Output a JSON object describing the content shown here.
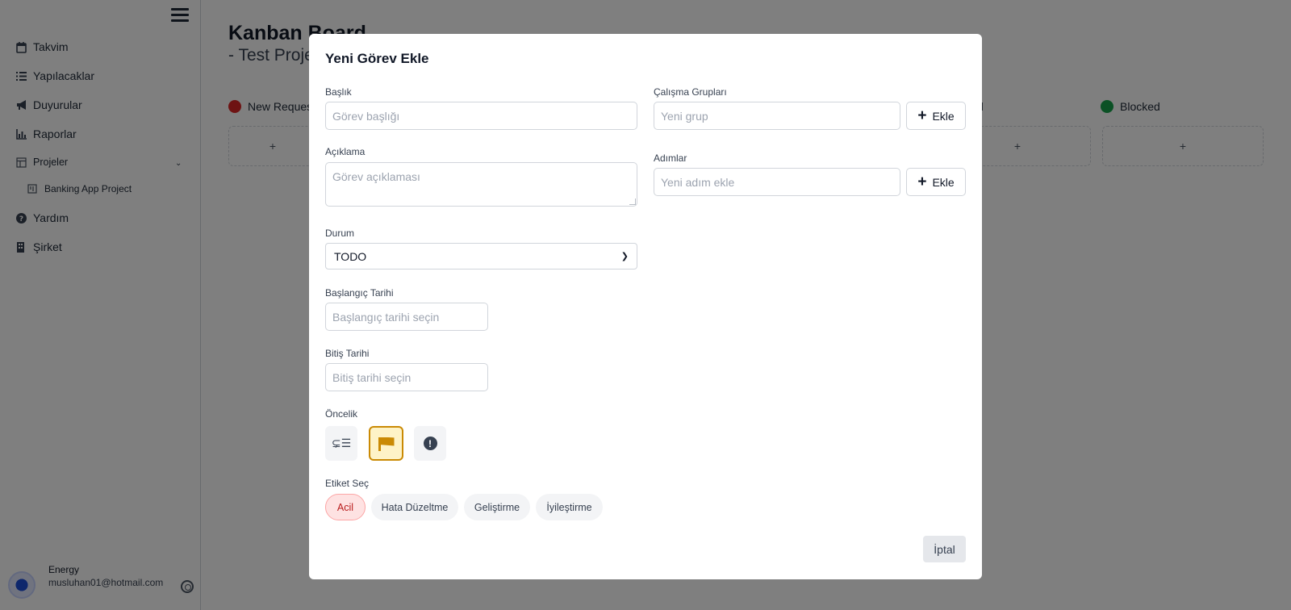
{
  "sidebar": {
    "items": [
      {
        "label": "Takvim",
        "icon": "calendar-icon"
      },
      {
        "label": "Yapılacaklar",
        "icon": "list-icon"
      },
      {
        "label": "Duyurular",
        "icon": "megaphone-icon"
      },
      {
        "label": "Raporlar",
        "icon": "chart-icon"
      },
      {
        "label": "Projeler",
        "icon": "table-icon"
      },
      {
        "label": "Banking App Project",
        "icon": "board-icon"
      },
      {
        "label": "Yardım",
        "icon": "help-icon"
      },
      {
        "label": "Şirket",
        "icon": "building-icon"
      }
    ],
    "user": {
      "name": "Energy",
      "email": "musluhan01@hotmail.com"
    }
  },
  "main": {
    "title": "Kanban Board",
    "subtitle": "- Test Proje",
    "columns": [
      {
        "label": "New Reques",
        "color": "#dc2626"
      },
      {
        "label": "d",
        "color": ""
      },
      {
        "label": "Blocked",
        "color": "#16a34a"
      }
    ],
    "add_symbol": "+"
  },
  "modal": {
    "title": "Yeni Görev Ekle",
    "baslik_label": "Başlık",
    "baslik_placeholder": "Görev başlığı",
    "aciklama_label": "Açıklama",
    "aciklama_placeholder": "Görev açıklaması",
    "durum_label": "Durum",
    "durum_value": "TODO",
    "baslangic_label": "Başlangıç Tarihi",
    "baslangic_placeholder": "Başlangıç tarihi seçin",
    "bitis_label": "Bitiş Tarihi",
    "bitis_placeholder": "Bitiş tarihi seçin",
    "oncelik_label": "Öncelik",
    "priority_low_glyph": "⊊☰",
    "priority_high_glyph": "!",
    "etiket_label": "Etiket Seç",
    "tags": [
      "Acil",
      "Hata Düzeltme",
      "Geliştirme",
      "İyileştirme"
    ],
    "gruplar_label": "Çalışma Grupları",
    "gruplar_placeholder": "Yeni grup",
    "adimlar_label": "Adımlar",
    "adimlar_placeholder": "Yeni adım ekle",
    "ekle_label": "Ekle",
    "iptal_label": "İptal"
  }
}
